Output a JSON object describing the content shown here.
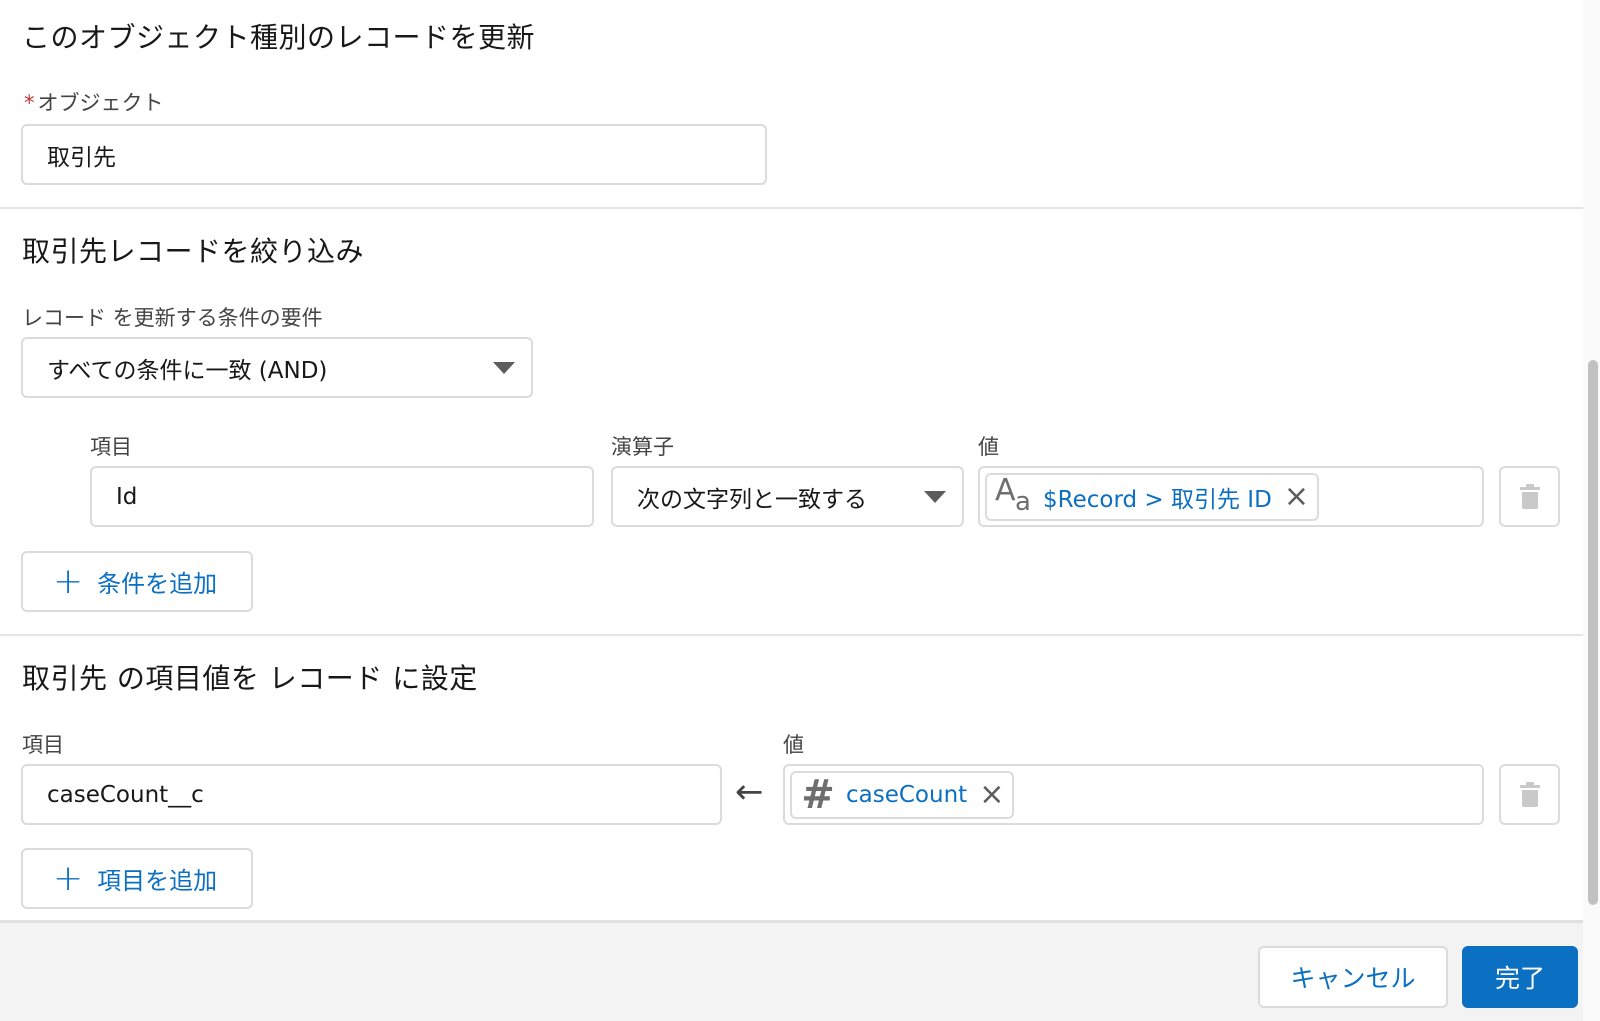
{
  "object_section": {
    "title": "このオブジェクト種別のレコードを更新",
    "required_mark": "*",
    "object_label": "オブジェクト",
    "object_value": "取引先"
  },
  "filter_section": {
    "title": "取引先レコードを絞り込み",
    "condition_label": "レコード を更新する条件の要件",
    "condition_value": "すべての条件に一致 (AND)",
    "field_label": "項目",
    "operator_label": "演算子",
    "value_label": "値",
    "row": {
      "field": "Id",
      "operator": "次の文字列と一致する",
      "value_pill": "$Record > 取引先 ID",
      "value_icon": "text-aa-icon"
    },
    "add_condition": "条件を追加"
  },
  "set_section": {
    "title": "取引先 の項目値を レコード に設定",
    "field_label": "項目",
    "value_label": "値",
    "row": {
      "field": "caseCount__c",
      "value_pill": "caseCount",
      "value_icon": "number-hash-icon"
    },
    "add_field": "項目を追加"
  },
  "footer": {
    "cancel": "キャンセル",
    "done": "完了"
  },
  "icons": {
    "close": "×",
    "plus": "+",
    "arrow": "←",
    "trash": "trash-icon"
  },
  "colors": {
    "link": "#0b6fc2",
    "brand_button": "#0b6fc2",
    "required": "#c23934"
  }
}
